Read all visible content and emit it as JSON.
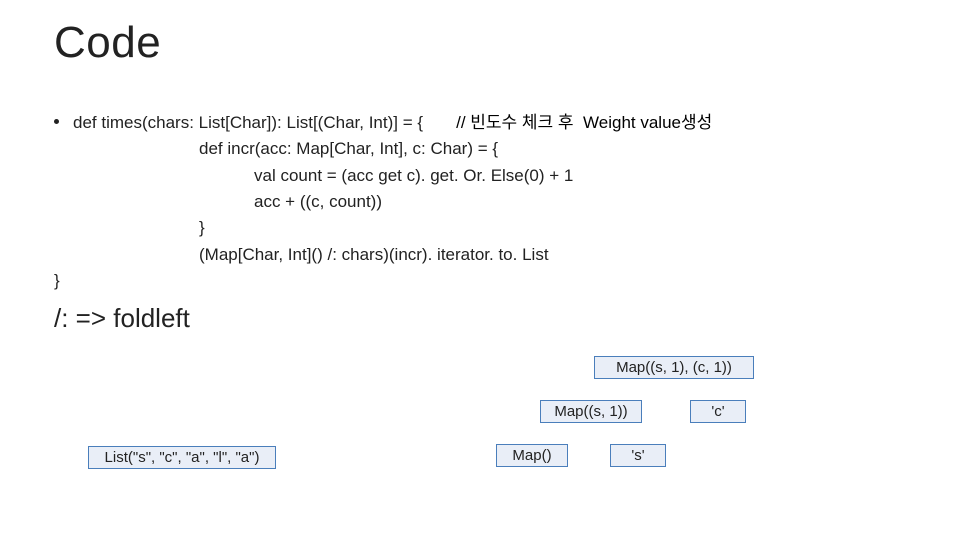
{
  "title": "Code",
  "bullet": {
    "line1_left": "def times(chars: List[Char]): List[(Char, Int)] = {",
    "line1_gap": "       ",
    "line1_comment": "// 빈도수 체크 후  ",
    "line1_weight": "Weight value생성",
    "line2": "def incr(acc: Map[Char, Int], c: Char) = {",
    "line3": "val count = (acc get c). get. Or. Else(0) + 1",
    "line4": "acc + ((c, count))",
    "line5": "}",
    "line6": "(Map[Char, Int]() /: chars)(incr). iterator. to. List",
    "close_brace": "}"
  },
  "foldleft": "/:  => foldleft",
  "boxes": {
    "list": "List(\"s\", \"c\", \"a\", \"l\", \"a\")",
    "map_empty": "Map()",
    "s_char": "'s'",
    "map_s1": "Map((s, 1))",
    "c_char": "'c'",
    "map_s1_c1": "Map((s, 1), (c, 1))"
  }
}
